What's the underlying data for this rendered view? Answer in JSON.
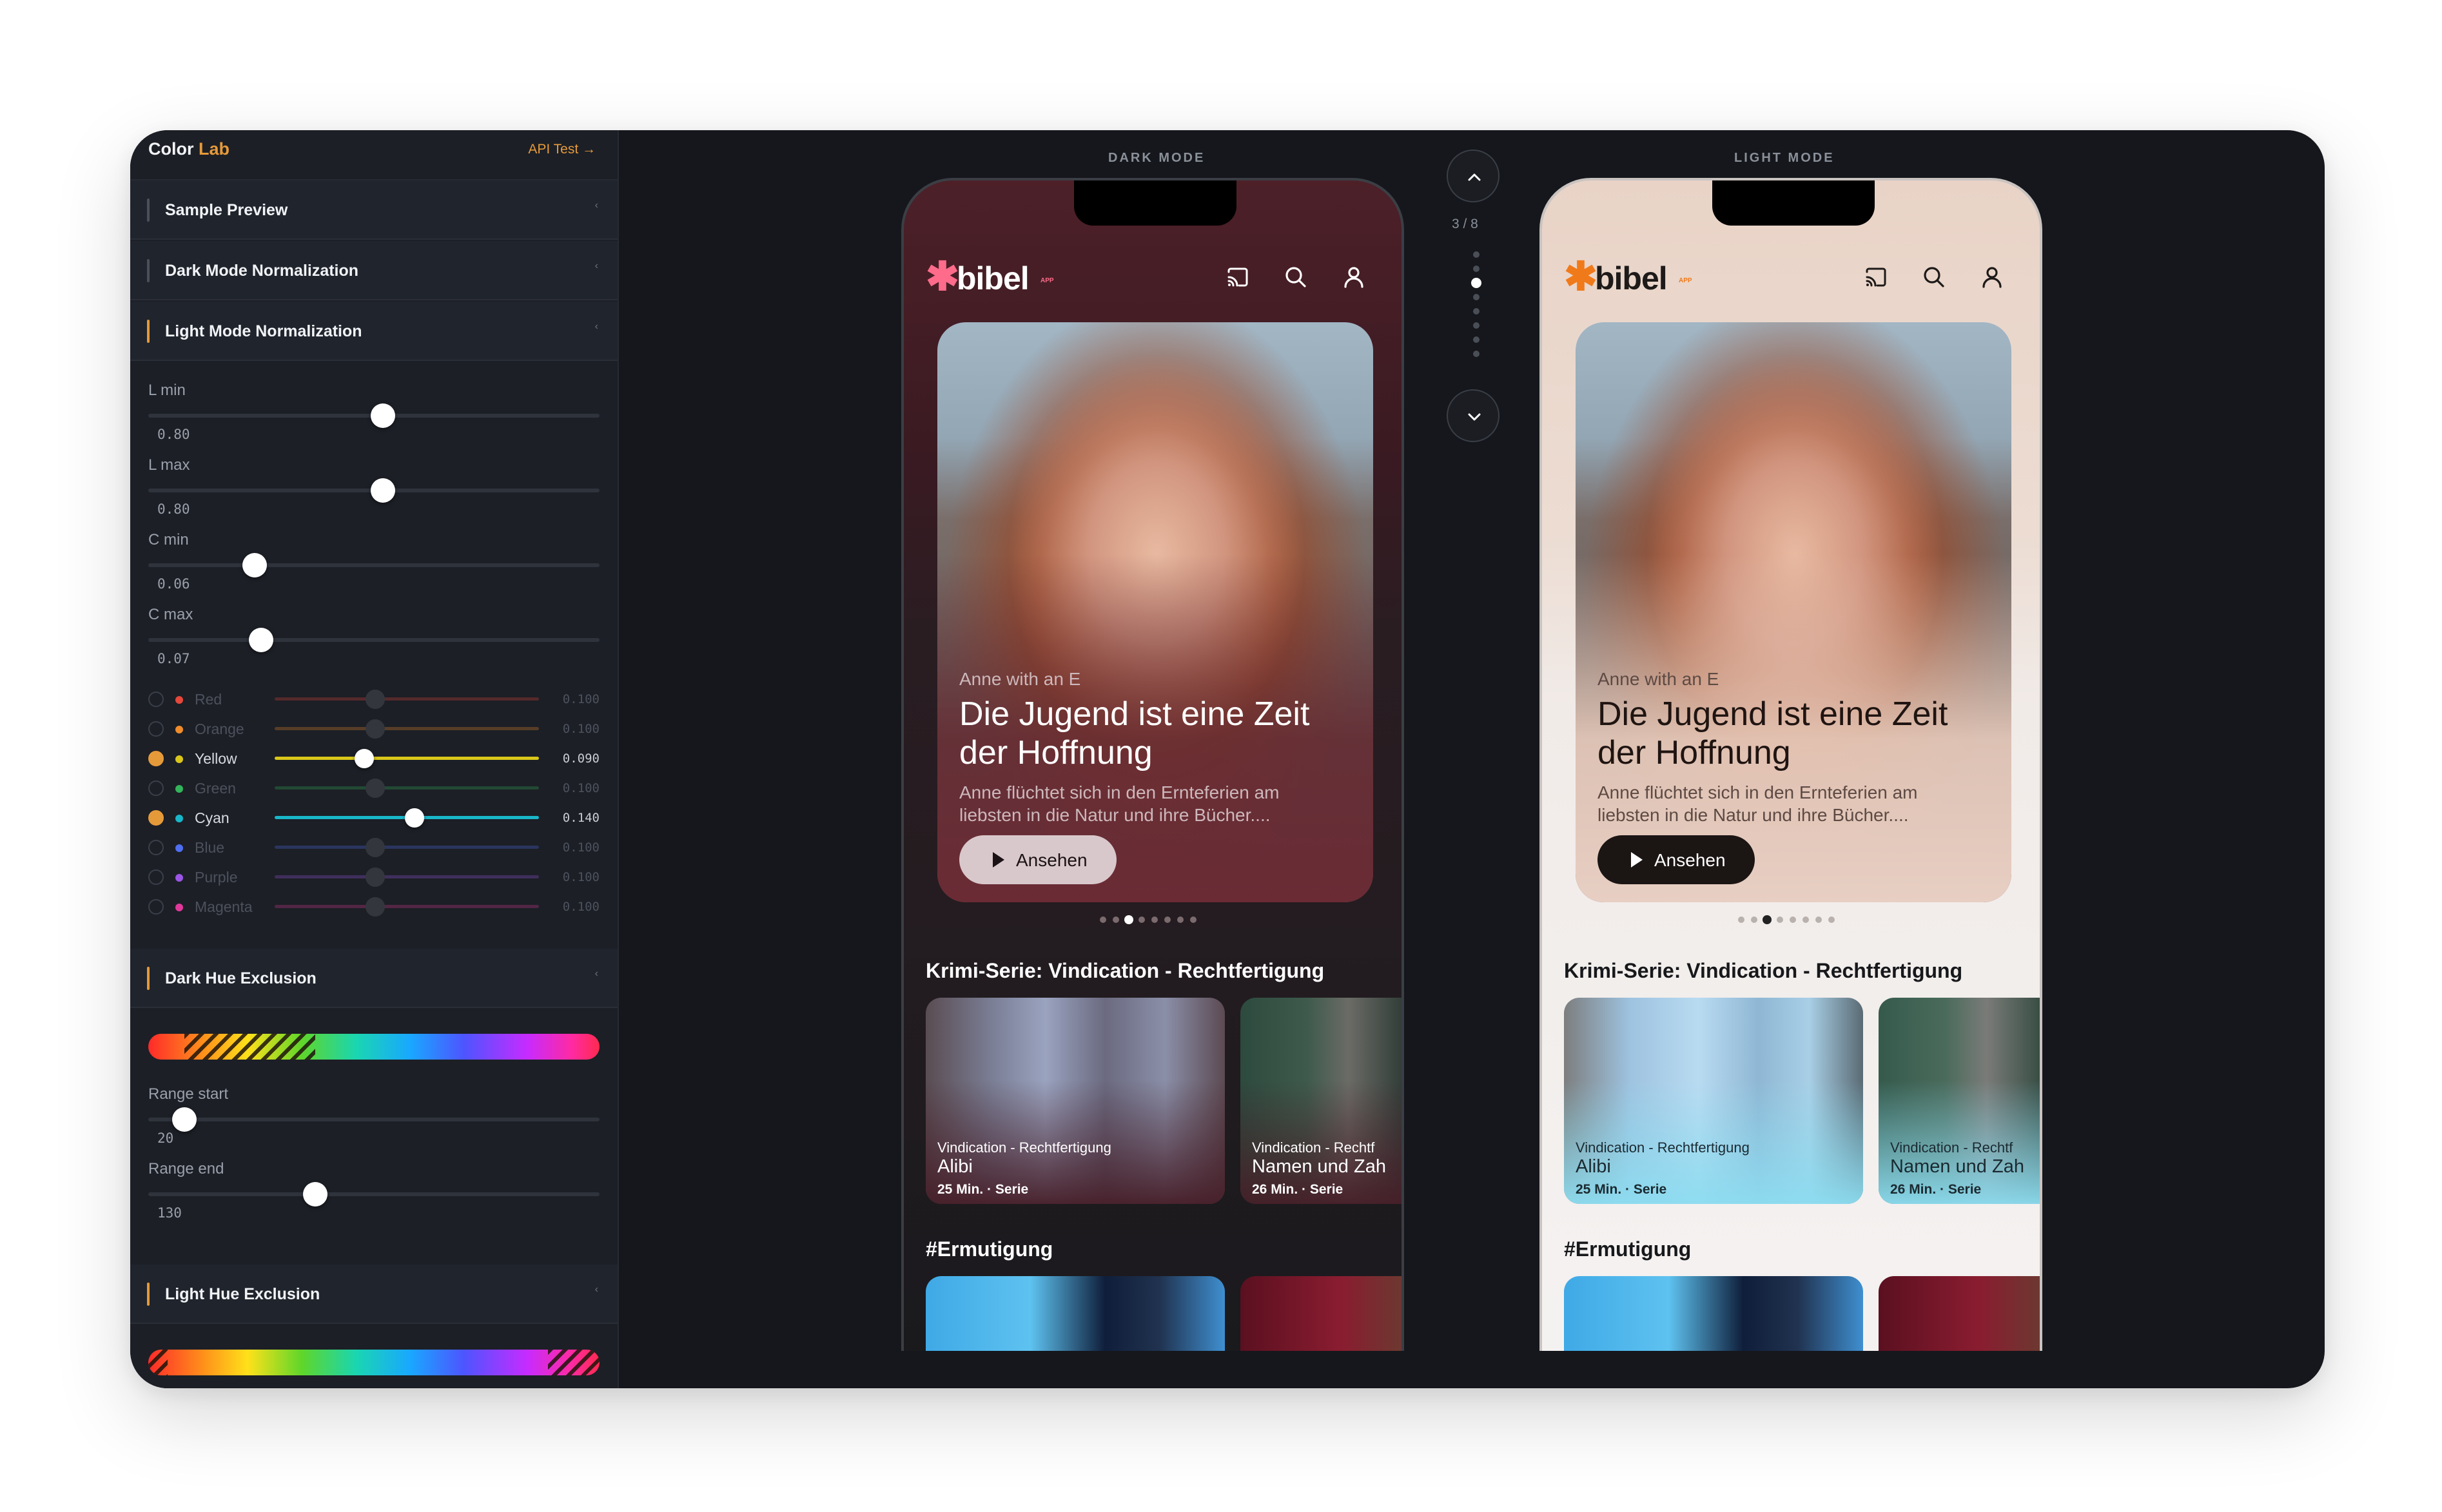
{
  "sidebar": {
    "title_main": "Color",
    "title_accent": "Lab",
    "api_link": "API Test →",
    "sections": [
      {
        "label": "Sample Preview",
        "chevron": "‹"
      },
      {
        "label": "Dark Mode Normalization",
        "chevron": "‹"
      },
      {
        "label": "Light Mode Normalization",
        "chevron": "‹"
      },
      {
        "label": "Dark Hue Exclusion",
        "chevron": "‹"
      },
      {
        "label": "Light Hue Exclusion",
        "chevron": "‹"
      }
    ],
    "light_norm": {
      "sliders": [
        {
          "label": "L min",
          "value": "0.80",
          "fraction": 0.52
        },
        {
          "label": "L max",
          "value": "0.80",
          "fraction": 0.52
        },
        {
          "label": "C min",
          "value": "0.06",
          "fraction": 0.235
        },
        {
          "label": "C max",
          "value": "0.07",
          "fraction": 0.25
        }
      ],
      "hues": [
        {
          "name": "Red",
          "value": "0.100",
          "enabled": false,
          "fraction": 0.38,
          "color": "#e5483b"
        },
        {
          "name": "Orange",
          "value": "0.100",
          "enabled": false,
          "fraction": 0.38,
          "color": "#f08c2a"
        },
        {
          "name": "Yellow",
          "value": "0.090",
          "enabled": true,
          "fraction": 0.34,
          "color": "#d9c61a"
        },
        {
          "name": "Green",
          "value": "0.100",
          "enabled": false,
          "fraction": 0.38,
          "color": "#33b45a"
        },
        {
          "name": "Cyan",
          "value": "0.140",
          "enabled": true,
          "fraction": 0.53,
          "color": "#19b6c9"
        },
        {
          "name": "Blue",
          "value": "0.100",
          "enabled": false,
          "fraction": 0.38,
          "color": "#4f6ff0"
        },
        {
          "name": "Purple",
          "value": "0.100",
          "enabled": false,
          "fraction": 0.38,
          "color": "#9b55e6"
        },
        {
          "name": "Magenta",
          "value": "0.100",
          "enabled": false,
          "fraction": 0.38,
          "color": "#e0389a"
        }
      ]
    },
    "dark_hue": {
      "range_start_label": "Range start",
      "range_start_value": "20",
      "range_start_fraction": 0.08,
      "range_end_label": "Range end",
      "range_end_value": "130",
      "range_end_fraction": 0.37
    }
  },
  "nav": {
    "counter": "3 / 8",
    "current": 3,
    "total": 8,
    "up_icon": "chevron-up-icon",
    "down_icon": "chevron-down-icon"
  },
  "dark": {
    "mode_label": "DARK MODE",
    "logo_word": "bibel",
    "logo_sup": "APP",
    "logo_color": "#ff6b8a",
    "hero": {
      "kicker": "Anne with an E",
      "title": "Die Jugend ist eine Zeit der Hoffnung",
      "desc": "Anne flüchtet sich in den Ernteferien am liebsten in die Natur und ihre Bücher....",
      "button": "Ansehen"
    },
    "pager": {
      "count": 8,
      "active": 2
    },
    "row1_title": "Krimi-Serie: Vindication - Rechtfertigung",
    "cards": [
      {
        "sub": "Vindication - Rechtfertigung",
        "title": "Alibi",
        "meta": "25 Min. · Serie"
      },
      {
        "sub": "Vindication - Rechtf",
        "title": "Namen und Zah",
        "meta": "26 Min. · Serie"
      }
    ],
    "row2_title": "#Ermutigung"
  },
  "light": {
    "mode_label": "LIGHT MODE",
    "logo_word": "bibel",
    "logo_sup": "APP",
    "logo_color": "#f07a1a",
    "hero": {
      "kicker": "Anne with an E",
      "title": "Die Jugend ist eine Zeit der Hoffnung",
      "desc": "Anne flüchtet sich in den Ernteferien am liebsten in die Natur und ihre Bücher....",
      "button": "Ansehen"
    },
    "pager": {
      "count": 8,
      "active": 2
    },
    "row1_title": "Krimi-Serie: Vindication - Rechtfertigung",
    "cards": [
      {
        "sub": "Vindication - Rechtfertigung",
        "title": "Alibi",
        "meta": "25 Min. · Serie"
      },
      {
        "sub": "Vindication - Rechtf",
        "title": "Namen und Zah",
        "meta": "26 Min. · Serie"
      }
    ],
    "row2_title": "#Ermutigung"
  },
  "icons": {
    "cast": "cast-icon",
    "search": "search-icon",
    "profile": "user-icon",
    "play": "play-icon"
  }
}
